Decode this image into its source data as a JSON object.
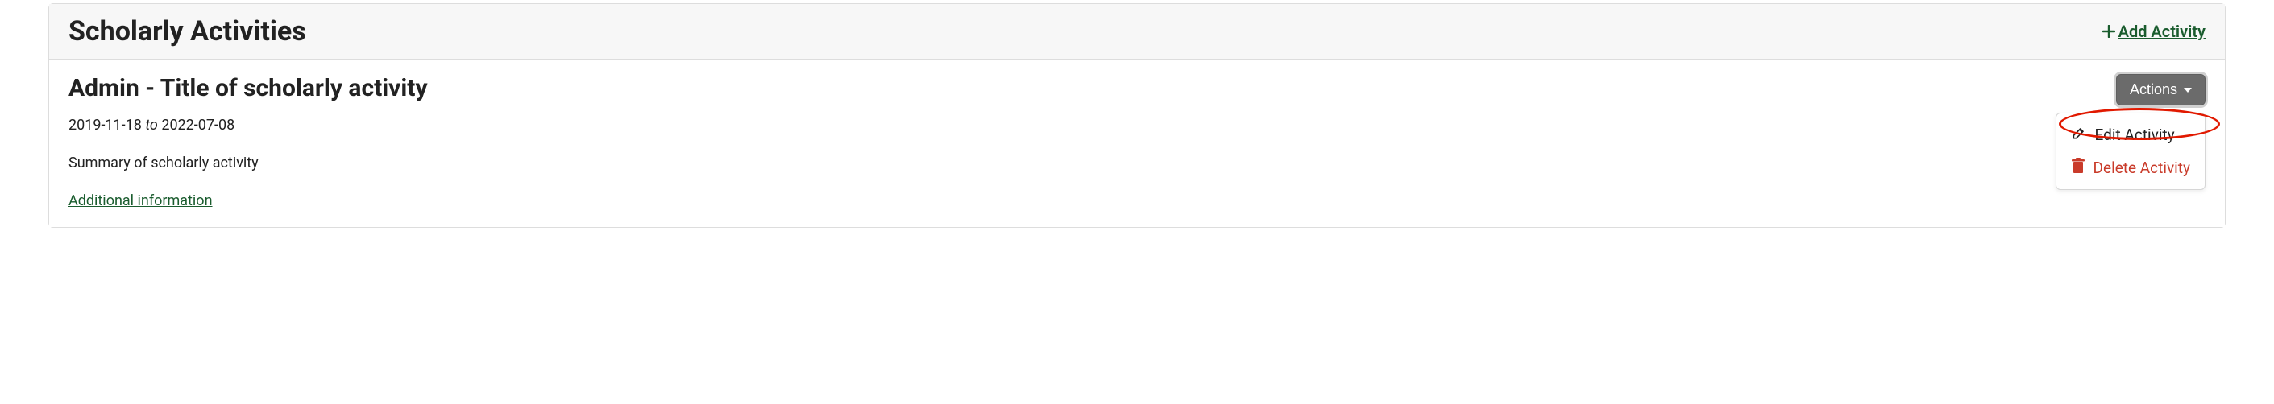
{
  "header": {
    "title": "Scholarly Activities",
    "add_label": "Add Activity"
  },
  "activity": {
    "title": "Admin - Title of scholarly activity",
    "date_start": "2019-11-18",
    "date_to_word": "to",
    "date_end": "2022-07-08",
    "summary": "Summary of scholarly activity",
    "additional_link": "Additional information"
  },
  "actions": {
    "button_label": "Actions",
    "items": [
      {
        "label": "Edit Activity"
      },
      {
        "label": "Delete Activity"
      }
    ]
  }
}
